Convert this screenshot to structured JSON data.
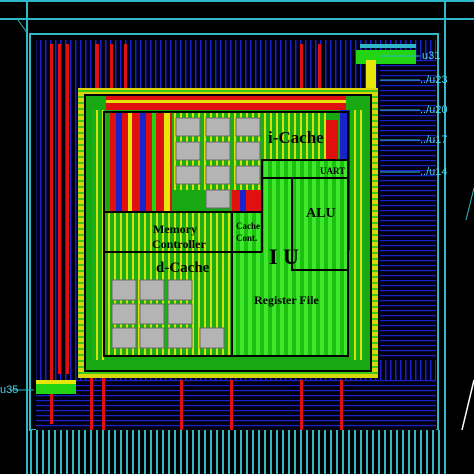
{
  "blocks": {
    "icache": "i-Cache",
    "uart": "UART",
    "alu": "ALU",
    "memory_controller_line1": "Memory",
    "memory_controller_line2": "Controller",
    "cache_cont_line1": "Cache",
    "cache_cont_line2": "Cont.",
    "iu": "I U",
    "dcache": "d-Cache",
    "register_file": "Register File"
  },
  "pins": {
    "u31": "u31",
    "u23": "../u23",
    "u20": "../u20",
    "u17": "../u17",
    "u14": "../u14",
    "u35": "u35"
  },
  "colors": {
    "metal_green": "#22d414",
    "metal_yellow": "#e6e60a",
    "metal_red": "#e01010",
    "metal_blue": "#1a22cc",
    "pad_cyan": "#2fb8c8",
    "sram_gray": "#b4b4b4"
  }
}
